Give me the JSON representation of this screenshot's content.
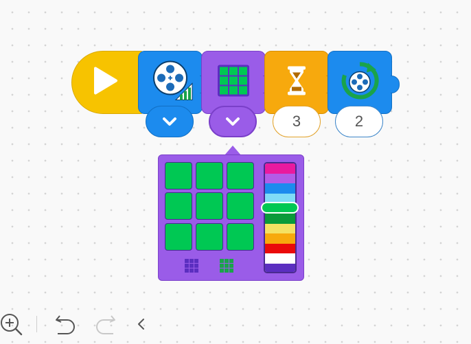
{
  "program": {
    "blocks": [
      {
        "name": "start",
        "icon": "play-icon",
        "color": "#f7c300"
      },
      {
        "name": "play-animation",
        "icon": "film-reel-volume-icon",
        "color": "#1c8bee"
      },
      {
        "name": "display-grid",
        "icon": "grid-icon",
        "color": "#9a5ce8"
      },
      {
        "name": "wait",
        "icon": "hourglass-icon",
        "color": "#f7a90d"
      },
      {
        "name": "repeat",
        "icon": "loop-film-icon",
        "color": "#1c8bee"
      }
    ],
    "params": {
      "wait_value": "3",
      "repeat_value": "2"
    }
  },
  "grid_popup": {
    "cells": [
      "#00c853",
      "#00c853",
      "#00c853",
      "#00c853",
      "#00c853",
      "#00c853",
      "#00c853",
      "#00c853",
      "#00c853"
    ],
    "palette_colors": [
      "#ea1a9f",
      "#b35ce8",
      "#1c8bee",
      "#7fdcf7",
      "#00c853",
      "#0a9a3a",
      "#f4e163",
      "#f7a90d",
      "#ea0a0a",
      "#ffffff",
      "#5b2ec0"
    ],
    "selected_color": "#00c853",
    "preset_icons": [
      "grid-purple-icon",
      "grid-green-icon"
    ]
  },
  "toolbar": {
    "icons": [
      "zoom-in-icon",
      "undo-icon",
      "redo-icon",
      "collapse-icon"
    ]
  }
}
